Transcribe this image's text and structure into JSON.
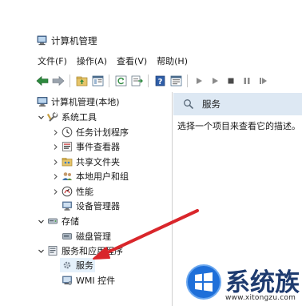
{
  "window": {
    "title": "计算机管理"
  },
  "menu": [
    {
      "label": "文件(F)"
    },
    {
      "label": "操作(A)"
    },
    {
      "label": "查看(V)"
    },
    {
      "label": "帮助(H)"
    }
  ],
  "toolbar_icons": [
    "back-arrow-icon",
    "forward-arrow-icon",
    "up-folder-icon",
    "show-hide-tree-icon",
    "refresh-icon",
    "export-list-icon",
    "help-icon",
    "properties-icon",
    "play-icon",
    "play-alt-icon",
    "stop-icon",
    "pause-icon",
    "restart-icon"
  ],
  "tree": {
    "root": "计算机管理(本地)",
    "system_tools": "系统工具",
    "task_scheduler": "任务计划程序",
    "event_viewer": "事件查看器",
    "shared_folders": "共享文件夹",
    "local_users": "本地用户和组",
    "performance": "性能",
    "device_manager": "设备管理器",
    "storage": "存储",
    "disk_management": "磁盘管理",
    "services_apps": "服务和应用程序",
    "services": "服务",
    "wmi": "WMI 控件"
  },
  "right": {
    "header": "服务",
    "description": "选择一个项目来查看它的描述。"
  },
  "watermark": {
    "brand": "系统族",
    "url": "www.xitongzu.com"
  },
  "colors": {
    "accent_blue": "#1e6fd9",
    "header_bg": "#dde8f3",
    "arrow_red": "#d9262b",
    "watermark_navy": "#1e3b6f"
  }
}
